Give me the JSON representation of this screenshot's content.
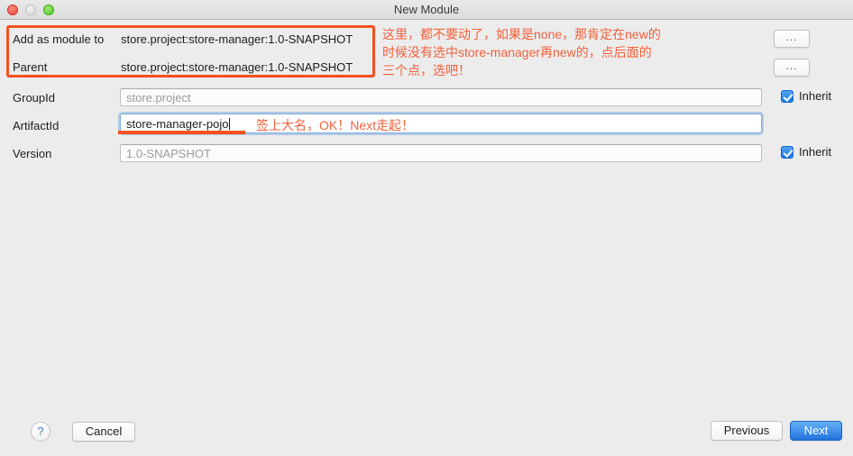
{
  "window": {
    "title": "New Module",
    "traffic_lights": [
      "close",
      "minimize",
      "zoom"
    ]
  },
  "form": {
    "add_as_module_to": {
      "label": "Add as module to",
      "value": "store.project:store-manager:1.0-SNAPSHOT",
      "browse_label": "..."
    },
    "parent": {
      "label": "Parent",
      "value": "store.project:store-manager:1.0-SNAPSHOT",
      "browse_label": "..."
    },
    "group_id": {
      "label": "GroupId",
      "value": "store.project",
      "inherit_label": "Inherit",
      "inherit_checked": true
    },
    "artifact_id": {
      "label": "ArtifactId",
      "value": "store-manager-pojo"
    },
    "version": {
      "label": "Version",
      "value": "1.0-SNAPSHOT",
      "inherit_label": "Inherit",
      "inherit_checked": true
    }
  },
  "annotations": {
    "color": "#f4511e",
    "top_note": "这里，都不要动了，如果是none，那肯定在new的\n时候没有选中store-manager再new的，点后面的\n三个点，选吧！",
    "artifact_note": "签上大名，OK！Next走起！"
  },
  "footer": {
    "help_label": "?",
    "cancel_label": "Cancel",
    "previous_label": "Previous",
    "next_label": "Next"
  }
}
